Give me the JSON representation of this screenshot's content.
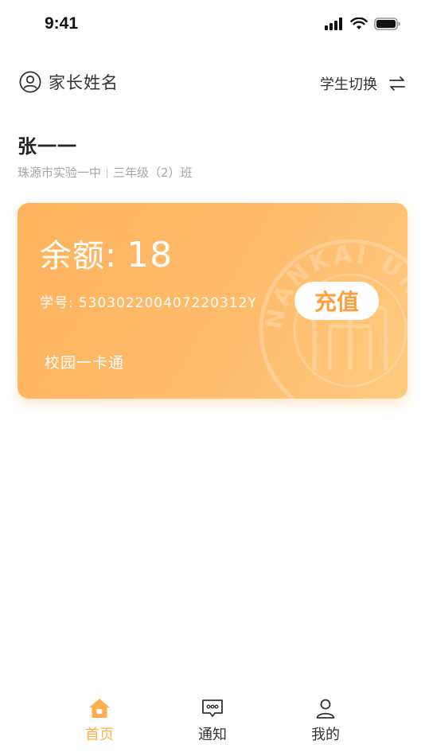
{
  "status_bar": {
    "time": "9:41"
  },
  "header": {
    "parent_name": "家长姓名",
    "switch_label": "学生切换"
  },
  "student": {
    "name": "张一一",
    "school": "珠源市实验一中",
    "class": "三年级（2）班"
  },
  "card": {
    "balance_label": "余额",
    "balance_colon": ":",
    "balance_value": "18",
    "id_label": "学号:",
    "id_value": "530302200407220312Y",
    "recharge_label": "充值",
    "title": "校园一卡通",
    "watermark_text": "NANKAI UNIV"
  },
  "tabbar": {
    "items": [
      {
        "label": "首页",
        "icon": "home-icon",
        "active": true
      },
      {
        "label": "通知",
        "icon": "message-icon",
        "active": false
      },
      {
        "label": "我的",
        "icon": "user-icon",
        "active": false
      }
    ]
  },
  "colors": {
    "accent": "#ffae52",
    "card_gradient_start": "#ffb25c",
    "card_gradient_end": "#ffca7e",
    "text_primary": "#333333",
    "text_secondary": "#a6a6a6"
  }
}
